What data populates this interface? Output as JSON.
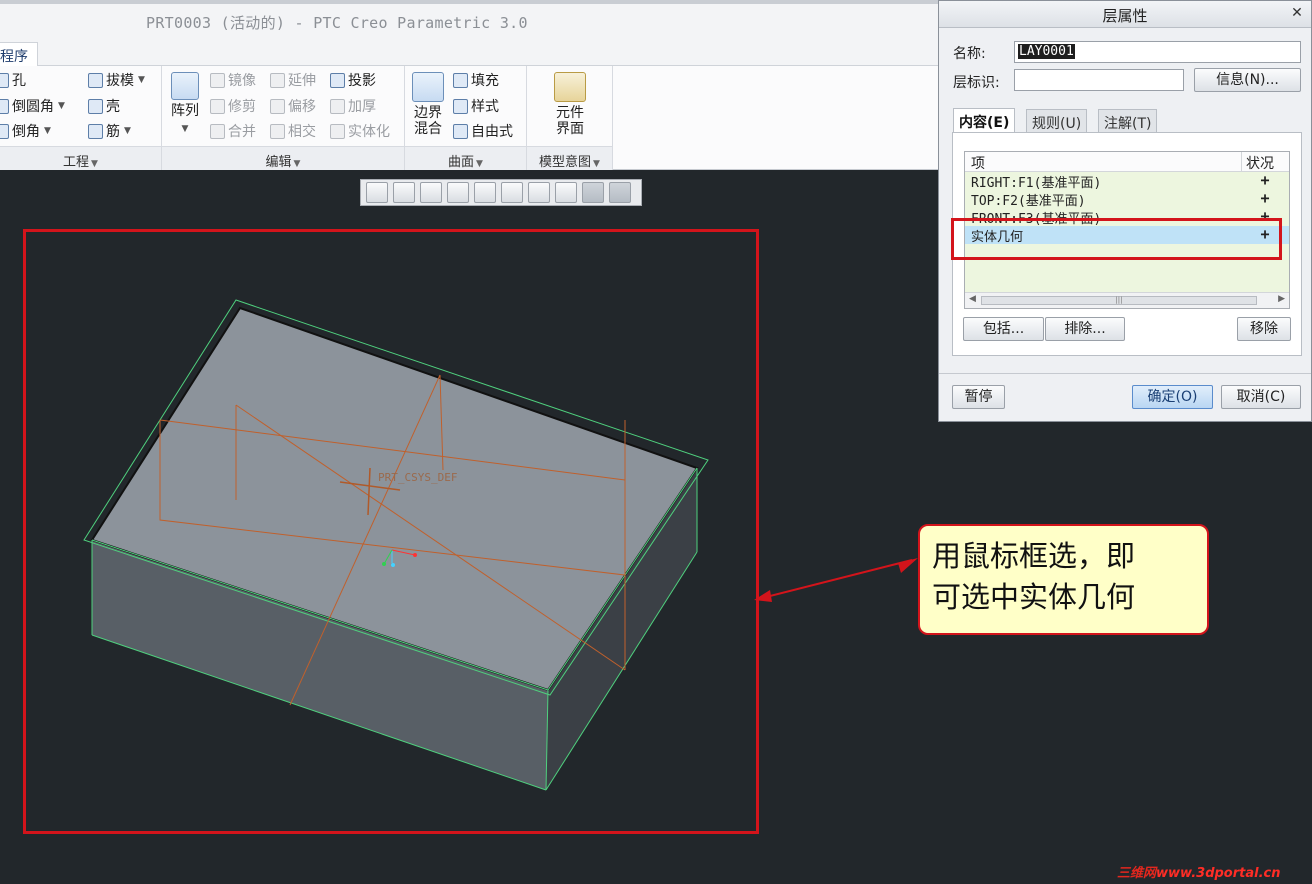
{
  "window": {
    "title": "PRT0003 (活动的) - PTC Creo Parametric 3.0"
  },
  "ribbon": {
    "active_tab": "程序",
    "groups": {
      "engineering": {
        "label": "工程",
        "hole": "孔",
        "round": "倒圆角",
        "chamfer": "倒角",
        "draft": "拔模",
        "shell": "壳",
        "rib": "筋"
      },
      "edit": {
        "label": "编辑",
        "pattern": "阵列",
        "mirror": "镜像",
        "trim": "修剪",
        "merge": "合并",
        "extend": "延伸",
        "offset": "偏移",
        "intersect": "相交",
        "project": "投影",
        "thicken": "加厚",
        "solidify": "实体化"
      },
      "surfaces": {
        "label": "曲面",
        "boundary_blend_line1": "边界",
        "boundary_blend_line2": "混合",
        "fill": "填充",
        "style": "样式",
        "freestyle": "自由式"
      },
      "model_intent": {
        "label": "模型意图",
        "component_interface_line1": "元件",
        "component_interface_line2": "界面"
      }
    }
  },
  "viewport": {
    "csys_label": "PRT_CSYS_DEF",
    "callout_line1": "用鼠标框选，即",
    "callout_line2": "可选中实体几何",
    "watermark_a": "三维网",
    "watermark_b": "www.3dportal.cn",
    "colors": {
      "background": "#22272b",
      "highlight_red": "#d3141b",
      "callout_fill": "#ffffc8"
    }
  },
  "dialog": {
    "title": "层属性",
    "name_label": "名称:",
    "name_value": "LAY0001",
    "layer_id_label": "层标识:",
    "layer_id_value": "",
    "info_button": "信息(N)...",
    "tabs": [
      "内容(E)",
      "规则(U)",
      "注解(T)"
    ],
    "list": {
      "col_item": "项",
      "col_status": "状况",
      "rows": [
        {
          "item": "RIGHT:F1(基准平面)",
          "status": "+"
        },
        {
          "item": "TOP:F2(基准平面)",
          "status": "+"
        },
        {
          "item": "FRONT:F3(基准平面)",
          "status": "+"
        },
        {
          "item": "实体几何",
          "status": "+",
          "selected": true
        }
      ]
    },
    "include_button": "包括...",
    "exclude_button": "排除...",
    "remove_button": "移除",
    "pause_button": "暂停",
    "ok_button": "确定(O)",
    "cancel_button": "取消(C)"
  }
}
